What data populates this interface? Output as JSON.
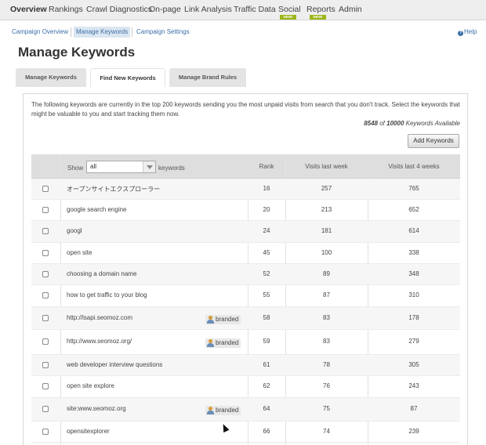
{
  "topnav": {
    "items": [
      "Overview",
      "Rankings",
      "Crawl Diagnostics",
      "On-page",
      "Link Analysis",
      "Traffic Data",
      "Social",
      "Reports",
      "Admin"
    ],
    "new_badge": "NEW!"
  },
  "subnav": {
    "campaign_overview": "Campaign Overview",
    "manage_keywords": "Manage Keywords",
    "campaign_settings": "Campaign Settings",
    "help": "Help"
  },
  "page_title": "Manage Keywords",
  "tabs": [
    "Manage Keywords",
    "Find New Keywords",
    "Manage Brand Rules"
  ],
  "intro_text": "The following keywords are currently in the top 200 keywords sending you the most unpaid visits from search that you don't track. Select the keywords that might be valuable to you and start tracking them now.",
  "available": {
    "count": "8548",
    "of": "of",
    "total": "10000",
    "label": "Keywords Available"
  },
  "add_keywords_button": "Add Keywords",
  "table": {
    "show_label": "Show",
    "show_value": "all",
    "keywords_label": "keywords",
    "headers": {
      "rank": "Rank",
      "visits_week": "Visits last week",
      "visits_4weeks": "Visits last 4 weeks"
    },
    "branded_label": "branded",
    "rows": [
      {
        "keyword": "オープンサイトエクスプローラー",
        "rank": "16",
        "week": "257",
        "four": "765",
        "branded": false
      },
      {
        "keyword": "google search engine",
        "rank": "20",
        "week": "213",
        "four": "652",
        "branded": false
      },
      {
        "keyword": "googl",
        "rank": "24",
        "week": "181",
        "four": "614",
        "branded": false
      },
      {
        "keyword": "open site",
        "rank": "45",
        "week": "100",
        "four": "338",
        "branded": false
      },
      {
        "keyword": "choosing a domain name",
        "rank": "52",
        "week": "89",
        "four": "348",
        "branded": false
      },
      {
        "keyword": "how to get traffic to your blog",
        "rank": "55",
        "week": "87",
        "four": "310",
        "branded": false
      },
      {
        "keyword": "http://lsapi.seomoz.com",
        "rank": "58",
        "week": "83",
        "four": "178",
        "branded": true
      },
      {
        "keyword": "http://www.seomoz.org/",
        "rank": "59",
        "week": "83",
        "four": "279",
        "branded": true
      },
      {
        "keyword": "web developer interview questions",
        "rank": "61",
        "week": "78",
        "four": "305",
        "branded": false
      },
      {
        "keyword": "open site explore",
        "rank": "62",
        "week": "76",
        "four": "243",
        "branded": false
      },
      {
        "keyword": "site:www.seomoz.org",
        "rank": "64",
        "week": "75",
        "four": "87",
        "branded": true
      },
      {
        "keyword": "opensitexplorer",
        "rank": "66",
        "week": "74",
        "four": "239",
        "branded": false
      }
    ]
  }
}
